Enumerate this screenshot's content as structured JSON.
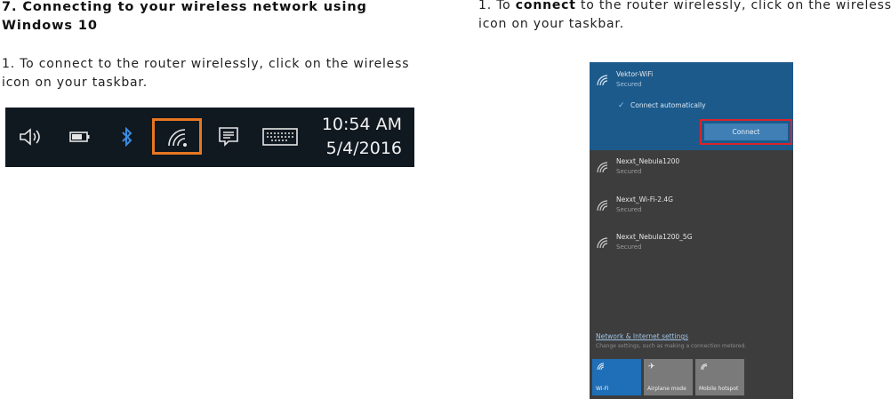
{
  "left": {
    "heading": "7. Connecting to your wireless network using Windows 10",
    "step_text": "1. To connect to the router wirelessly, click on the wireless icon on your taskbar."
  },
  "right": {
    "step_prefix": "1. To ",
    "step_bold": "connect",
    "step_suffix": " to the router wirelessly, click on the wireless icon on your taskbar."
  },
  "taskbar": {
    "icons": [
      "volume-icon",
      "battery-icon",
      "bluetooth-icon",
      "wifi-icon",
      "action-center-icon",
      "keyboard-icon"
    ],
    "time": "10:54 AM",
    "date": "5/4/2016",
    "highlight_color": "#e87722",
    "background": "#101820"
  },
  "flyout": {
    "background": "#3d3d3d",
    "active_background": "#1c5a8c",
    "highlight_color": "#d9242b",
    "selected": {
      "name": "Vektor-WiFi",
      "status": "Secured",
      "connect_automatically": "Connect automatically",
      "connect_button": "Connect"
    },
    "networks": [
      {
        "name": "Nexxt_Nebula1200",
        "status": "Secured"
      },
      {
        "name": "Nexxt_Wi-Fi-2.4G",
        "status": "Secured"
      },
      {
        "name": "Nexxt_Nebula1200_5G",
        "status": "Secured"
      }
    ],
    "settings_link": "Network & Internet settings",
    "settings_desc": "Change settings, such as making a connection metered.",
    "quick_actions": [
      {
        "label": "Wi-Fi",
        "icon": "wifi-icon",
        "active": true
      },
      {
        "label": "Airplane mode",
        "icon": "airplane-icon",
        "active": false
      },
      {
        "label": "Mobile hotspot",
        "icon": "hotspot-icon",
        "active": false
      }
    ]
  }
}
